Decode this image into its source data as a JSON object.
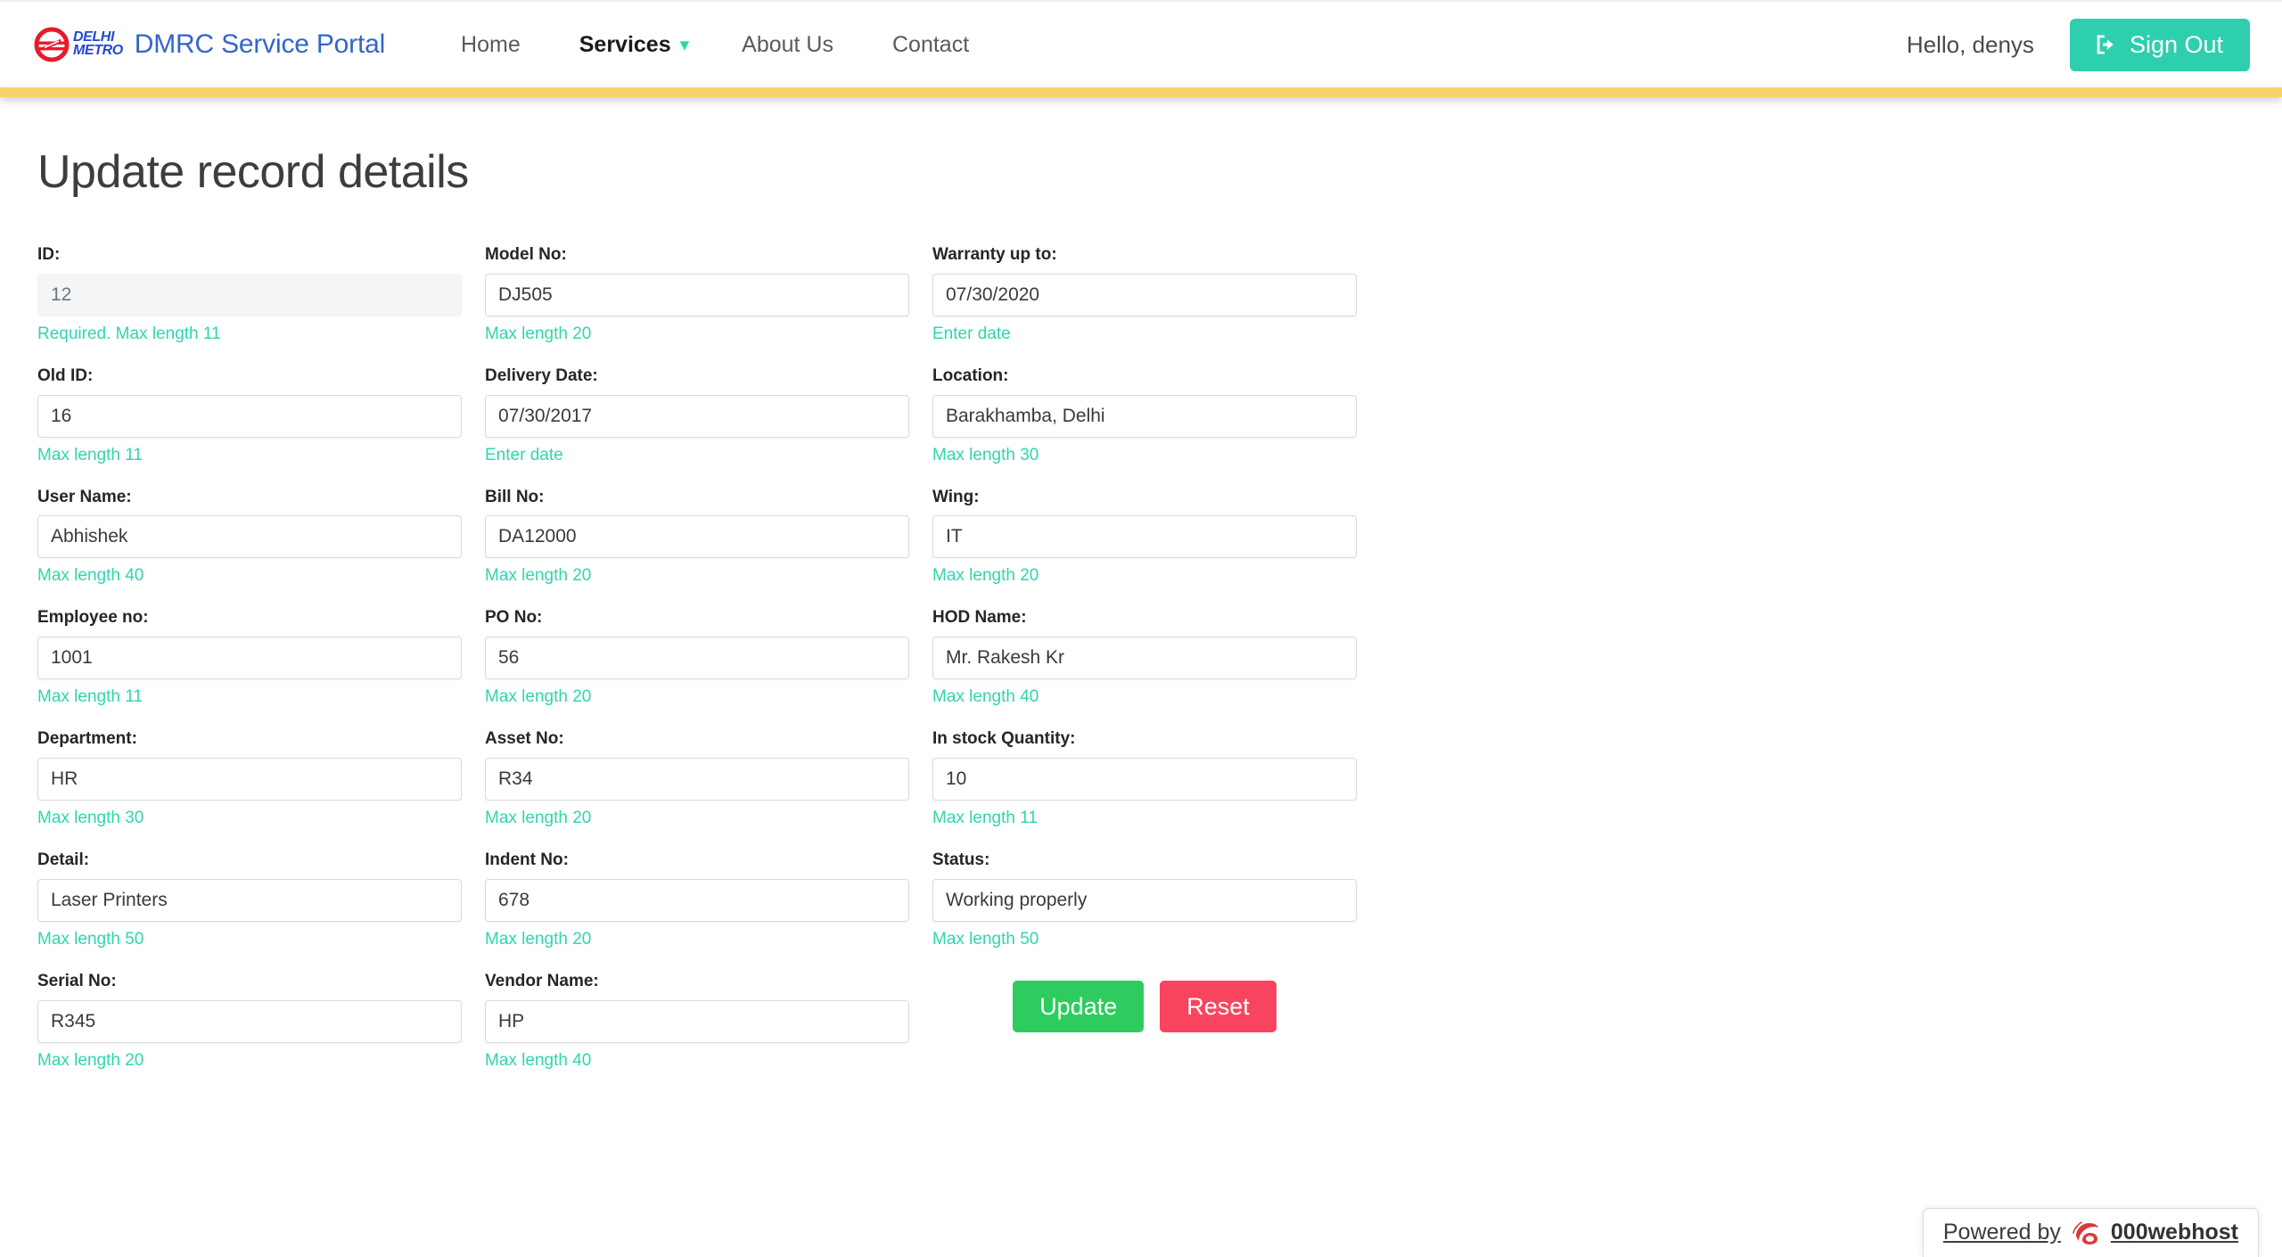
{
  "navbar": {
    "logo_icon": "delhi-metro-logo",
    "logo_line1": "DELHI",
    "logo_line2": "METRO",
    "brand_title": "DMRC Service Portal",
    "links": [
      {
        "label": "Home",
        "active": false,
        "has_chevron": false
      },
      {
        "label": "Services",
        "active": true,
        "has_chevron": true
      },
      {
        "label": "About Us",
        "active": false,
        "has_chevron": false
      },
      {
        "label": "Contact",
        "active": false,
        "has_chevron": false
      }
    ],
    "chevron_icon": "chevron-down-icon",
    "greeting": "Hello, denys",
    "signout_label": "Sign Out",
    "signout_icon": "sign-out-icon",
    "accent_teal": "#2ecfae",
    "gold_bar_color": "#f8d36d"
  },
  "page": {
    "title": "Update record details"
  },
  "form": {
    "columns": [
      {
        "fields": [
          {
            "label": "ID:",
            "value": "12",
            "help": "Required. Max length 11",
            "disabled": true
          },
          {
            "label": "Old ID:",
            "value": "16",
            "help": "Max length 11",
            "disabled": false
          },
          {
            "label": "User Name:",
            "value": "Abhishek",
            "help": "Max length 40",
            "disabled": false
          },
          {
            "label": "Employee no:",
            "value": "1001",
            "help": "Max length 11",
            "disabled": false
          },
          {
            "label": "Department:",
            "value": "HR",
            "help": "Max length 30",
            "disabled": false
          },
          {
            "label": "Detail:",
            "value": "Laser Printers",
            "help": "Max length 50",
            "disabled": false
          },
          {
            "label": "Serial No:",
            "value": "R345",
            "help": "Max length 20",
            "disabled": false
          }
        ]
      },
      {
        "fields": [
          {
            "label": "Model No:",
            "value": "DJ505",
            "help": "Max length 20",
            "disabled": false
          },
          {
            "label": "Delivery Date:",
            "value": "07/30/2017",
            "help": "Enter date",
            "disabled": false
          },
          {
            "label": "Bill No:",
            "value": "DA12000",
            "help": "Max length 20",
            "disabled": false
          },
          {
            "label": "PO No:",
            "value": "56",
            "help": "Max length 20",
            "disabled": false
          },
          {
            "label": "Asset No:",
            "value": "R34",
            "help": "Max length 20",
            "disabled": false
          },
          {
            "label": "Indent No:",
            "value": "678",
            "help": "Max length 20",
            "disabled": false
          },
          {
            "label": "Vendor Name:",
            "value": "HP",
            "help": "Max length 40",
            "disabled": false
          }
        ]
      },
      {
        "fields": [
          {
            "label": "Warranty up to:",
            "value": "07/30/2020",
            "help": "Enter date",
            "disabled": false
          },
          {
            "label": "Location:",
            "value": "Barakhamba, Delhi",
            "help": "Max length 30",
            "disabled": false
          },
          {
            "label": "Wing:",
            "value": "IT",
            "help": "Max length 20",
            "disabled": false
          },
          {
            "label": "HOD Name:",
            "value": "Mr. Rakesh Kr",
            "help": "Max length 40",
            "disabled": false
          },
          {
            "label": "In stock Quantity:",
            "value": "10",
            "help": "Max length 11",
            "disabled": false
          },
          {
            "label": "Status:",
            "value": "Working properly",
            "help": "Max length 50",
            "disabled": false
          }
        ]
      }
    ],
    "buttons": {
      "update_label": "Update",
      "reset_label": "Reset",
      "update_color": "#2ecc5f",
      "reset_color": "#f9445f"
    },
    "help_color": "#2fd6ac"
  },
  "footer_badge": {
    "prefix": "Powered by",
    "name": "000webhost",
    "logo_icon": "000webhost-logo"
  }
}
